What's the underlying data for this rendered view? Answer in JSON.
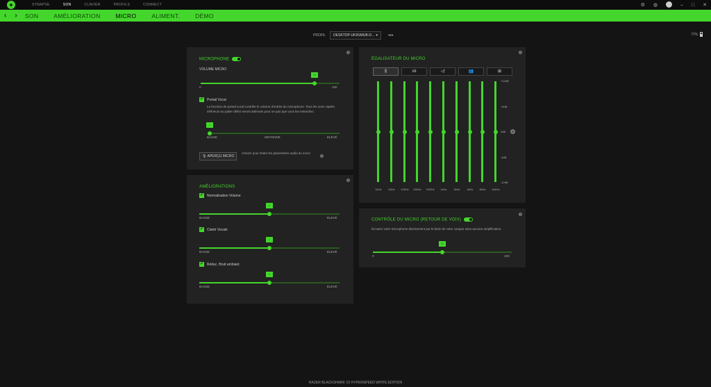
{
  "titlebar": {
    "nav": [
      "SYNAPSE",
      "SON",
      "CLAVIER",
      "PROFILS",
      "CONNECT"
    ],
    "active": "SON"
  },
  "subnav": {
    "tabs": [
      "SON",
      "AMÉLIORATION",
      "MICRO",
      "ALIMENT.",
      "DÉMO"
    ],
    "active": "MICRO"
  },
  "profile": {
    "label": "PROFIL",
    "value": "DESKTOP-UK9SMUB-D...",
    "more": "•••"
  },
  "battery": {
    "value": "77%"
  },
  "microphone": {
    "title": "MICROPHONE",
    "enabled": true,
    "volume_label": "VOLUME MICRO",
    "volume": 85,
    "volume_min": "0",
    "volume_max": "100",
    "gate_label": "Portail Vocal",
    "gate_desc": "La fonction de portail vocal contrôle le volume d'entrée du microphone. Tous les sons captés inférieurs au palier défini seront atténués pour ne pas que vous les entendiez.",
    "gate_value": "1",
    "gate_low": "BASSE",
    "gate_mid": "MOYENNE",
    "gate_high": "ÉLEVÉ",
    "preview_button": "APERÇU MICRO",
    "preview_desc": "Activez pour tester les paramètres audio du micro"
  },
  "enhancements": {
    "title": "AMÉLIORATIONS",
    "items": [
      {
        "label": "Normalisation Volume",
        "value": "3",
        "low": "BASSE",
        "high": "ÉLEVÉ"
      },
      {
        "label": "Clarté Vocale",
        "value": "3",
        "low": "BASSE",
        "high": "ÉLEVÉ"
      },
      {
        "label": "Réduc. Bruit ambiant",
        "value": "3",
        "low": "BASSE",
        "high": "ÉLEVÉ"
      }
    ]
  },
  "equalizer": {
    "title": "ÉGALISATEUR DU MICRO",
    "db_labels": [
      "+12dB",
      "+6dB",
      "0dB",
      "-6dB",
      "-12dB"
    ],
    "bands": [
      "31Hz",
      "63Hz",
      "125Hz",
      "250Hz",
      "500Hz",
      "1kHz",
      "2kHz",
      "4kHz",
      "8kHz",
      "16kHz"
    ],
    "band_values_db": [
      0,
      0,
      0,
      0,
      0,
      0,
      0,
      0,
      0,
      0
    ]
  },
  "sidetone": {
    "title": "CONTRÔLE DU MICRO (RETOUR DE VOIX)",
    "enabled": true,
    "desc": "Écoutez votre microphone directement par le biais de votre casque sans aucune amplification.",
    "value": 50,
    "min": "0",
    "max": "100"
  },
  "footer": {
    "device": "RAZER BLACKSHARK V2 HYPERSPEED WHITE EDITION"
  },
  "colors": {
    "accent": "#44d62c",
    "panel": "#222222",
    "background": "#141414"
  }
}
